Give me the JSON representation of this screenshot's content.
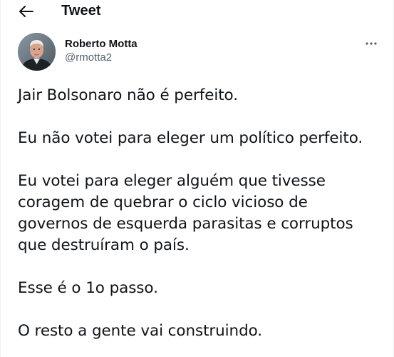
{
  "header": {
    "back_icon": "arrow-left-icon",
    "title": "Tweet"
  },
  "author": {
    "display_name": "Roberto Motta",
    "handle": "@rmotta2",
    "avatar_icon": "user-avatar",
    "more_icon": "more-horizontal-icon"
  },
  "tweet": {
    "paragraphs": [
      [
        "Jair Bolsonaro não é perfeito."
      ],
      [
        "Eu não votei para eleger um político perfeito."
      ],
      [
        "Eu votei para eleger alguém que tivesse",
        "coragem de quebrar o ciclo vicioso de",
        "governos de esquerda parasitas e corruptos",
        "que destruíram o país."
      ],
      [
        "Esse é o 1o passo."
      ],
      [
        "O resto a gente vai construindo."
      ]
    ]
  },
  "colors": {
    "text": "#0f1419",
    "secondary_text": "#536471",
    "background": "#ffffff"
  }
}
